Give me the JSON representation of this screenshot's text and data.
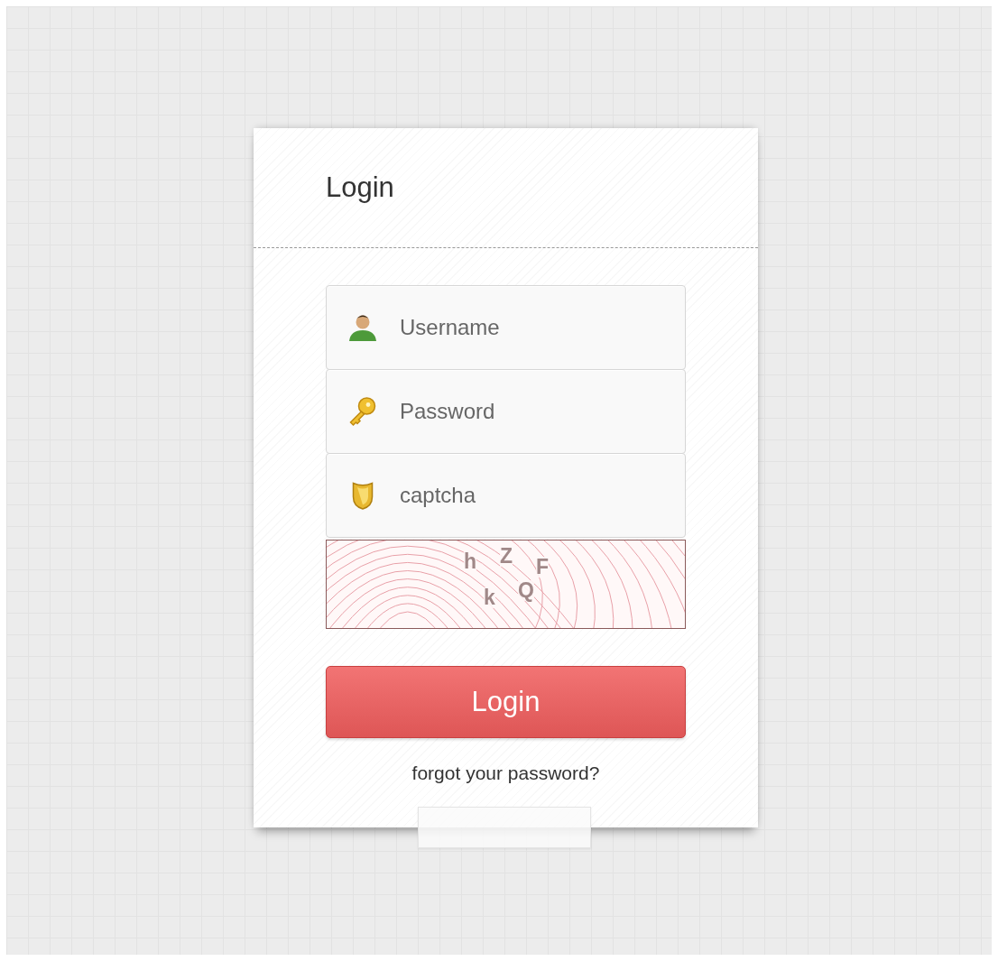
{
  "form": {
    "title": "Login",
    "fields": [
      {
        "kind": "user",
        "placeholder": "Username"
      },
      {
        "kind": "key",
        "placeholder": "Password"
      },
      {
        "kind": "shield",
        "placeholder": "captcha"
      }
    ],
    "captcha_image": {
      "characters": [
        "h",
        "Z",
        "F",
        "k",
        "Q"
      ]
    },
    "submit": "Login",
    "forgot_link": "forgot your password?"
  }
}
